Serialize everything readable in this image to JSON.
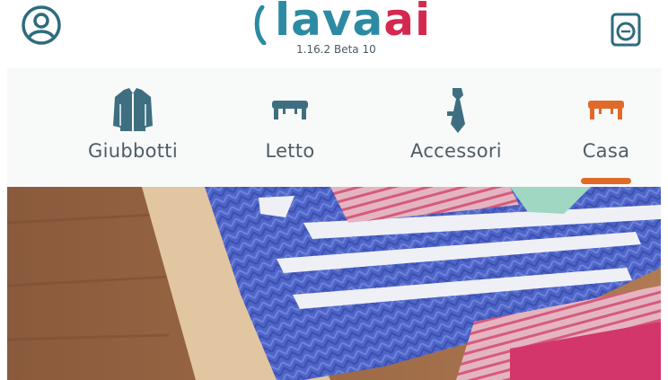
{
  "header": {
    "brand_blue": "lava",
    "brand_red": "ai",
    "version": "1.16.2 Beta 10"
  },
  "categories": [
    {
      "label": "Giubbotti",
      "icon": "jacket-icon",
      "active": false
    },
    {
      "label": "Letto",
      "icon": "bed-icon",
      "active": false
    },
    {
      "label": "Accessori",
      "icon": "tie-icon",
      "active": false
    },
    {
      "label": "Casa",
      "icon": "table-icon",
      "active": true
    }
  ],
  "colors": {
    "brand_blue": "#2d8aa3",
    "brand_red": "#d4294f",
    "icon_slate": "#3e6f80",
    "active_orange": "#e06a2a"
  },
  "hero": {
    "image": "folded-kitchen-towels-photo"
  }
}
